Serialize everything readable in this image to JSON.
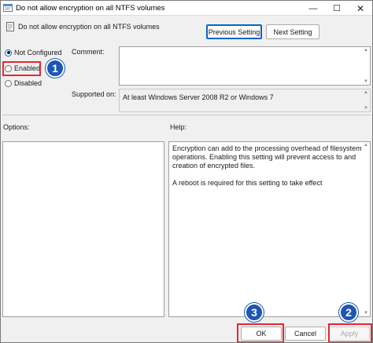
{
  "window": {
    "title": "Do not allow encryption on all NTFS volumes",
    "minimize_icon": "minimize-icon",
    "maximize_icon": "maximize-icon",
    "close_icon": "close-icon"
  },
  "header": {
    "policy_name": "Do not allow encryption on all NTFS volumes",
    "previous_label": "Previous Setting",
    "next_label": "Next Setting"
  },
  "state": {
    "options": [
      {
        "label": "Not Configured",
        "checked": true
      },
      {
        "label": "Enabled",
        "checked": false
      },
      {
        "label": "Disabled",
        "checked": false
      }
    ]
  },
  "comment": {
    "label": "Comment:",
    "value": ""
  },
  "supported": {
    "label": "Supported on:",
    "value": "At least Windows Server 2008 R2 or Windows 7"
  },
  "options_panel": {
    "label": "Options:"
  },
  "help_panel": {
    "label": "Help:",
    "paragraphs": [
      "Encryption can add to the processing overhead of filesystem operations.  Enabling this setting will prevent access to and creation of encrypted files.",
      "A reboot is required for this setting to take effect"
    ]
  },
  "footer": {
    "ok_label": "OK",
    "cancel_label": "Cancel",
    "apply_label": "Apply"
  },
  "callouts": {
    "enabled_step": "1",
    "apply_step": "2",
    "ok_step": "3"
  },
  "colors": {
    "highlight_red": "#e5262f",
    "callout_blue": "#1e56b5",
    "accent_blue": "#0a64c8"
  }
}
